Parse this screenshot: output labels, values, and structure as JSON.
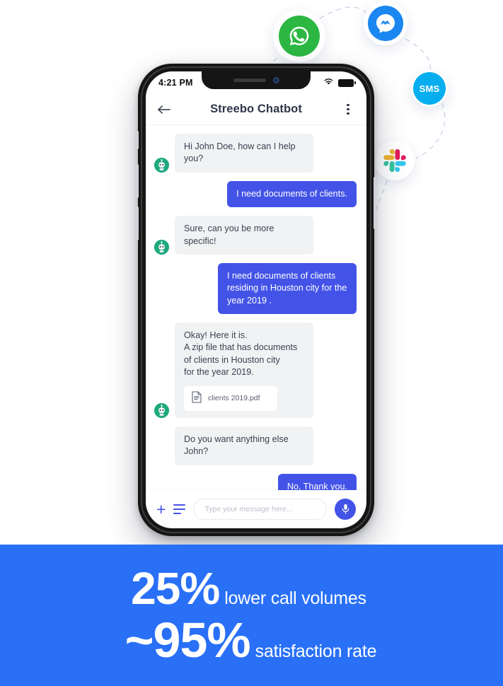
{
  "hero": {
    "channels": [
      {
        "id": "whatsapp",
        "name": "WhatsApp",
        "icon": "whatsapp-icon",
        "color": "#2CB742"
      },
      {
        "id": "messenger",
        "name": "Messenger",
        "icon": "messenger-icon",
        "color": "#1B87F0"
      },
      {
        "id": "sms",
        "name": "SMS",
        "icon": "sms-icon",
        "color": "#06AEEF",
        "label": "SMS"
      },
      {
        "id": "slack",
        "name": "Slack",
        "icon": "slack-icon",
        "color": "#E01E5A"
      }
    ]
  },
  "phone": {
    "status_bar": {
      "time": "4:21 PM",
      "wifi_icon": "wifi-icon",
      "battery_icon": "battery-icon"
    },
    "header": {
      "back_icon": "back-arrow-icon",
      "title": "Streebo Chatbot",
      "menu_icon": "more-vertical-icon"
    },
    "messages": [
      {
        "sender": "bot",
        "avatar": "bot-avatar",
        "text": "Hi John Doe, how can I help you?"
      },
      {
        "sender": "user",
        "text": "I need documents of clients."
      },
      {
        "sender": "bot",
        "avatar": "bot-avatar",
        "text": "Sure, can you be more specific!"
      },
      {
        "sender": "user",
        "text": "I need documents of clients residing in Houston city for the year 2019 ."
      },
      {
        "sender": "bot",
        "avatar": "bot-avatar",
        "text": "Okay! Here it is.\nA zip file that has documents of clients in Houston city\nfor the year 2019.",
        "attachment": {
          "icon": "document-icon",
          "filename": "clients 2019.pdf"
        }
      },
      {
        "sender": "bot",
        "text": "Do you want anything else John?"
      },
      {
        "sender": "user",
        "text": "No, Thank you."
      }
    ],
    "input_bar": {
      "add_icon": "plus-icon",
      "menu_icon": "list-lines-icon",
      "placeholder": "Type your message here...",
      "value": "",
      "mic_icon": "microphone-icon"
    }
  },
  "stats": {
    "background_color": "#2970F7",
    "items": [
      {
        "number": "25%",
        "label": "lower call volumes"
      },
      {
        "number": "~95%",
        "label": "satisfaction rate"
      }
    ]
  },
  "colors": {
    "user_bubble": "#4353E8",
    "bot_bubble": "#f1f2f4",
    "banner": "#2970F7",
    "accent": "#4353E8"
  }
}
